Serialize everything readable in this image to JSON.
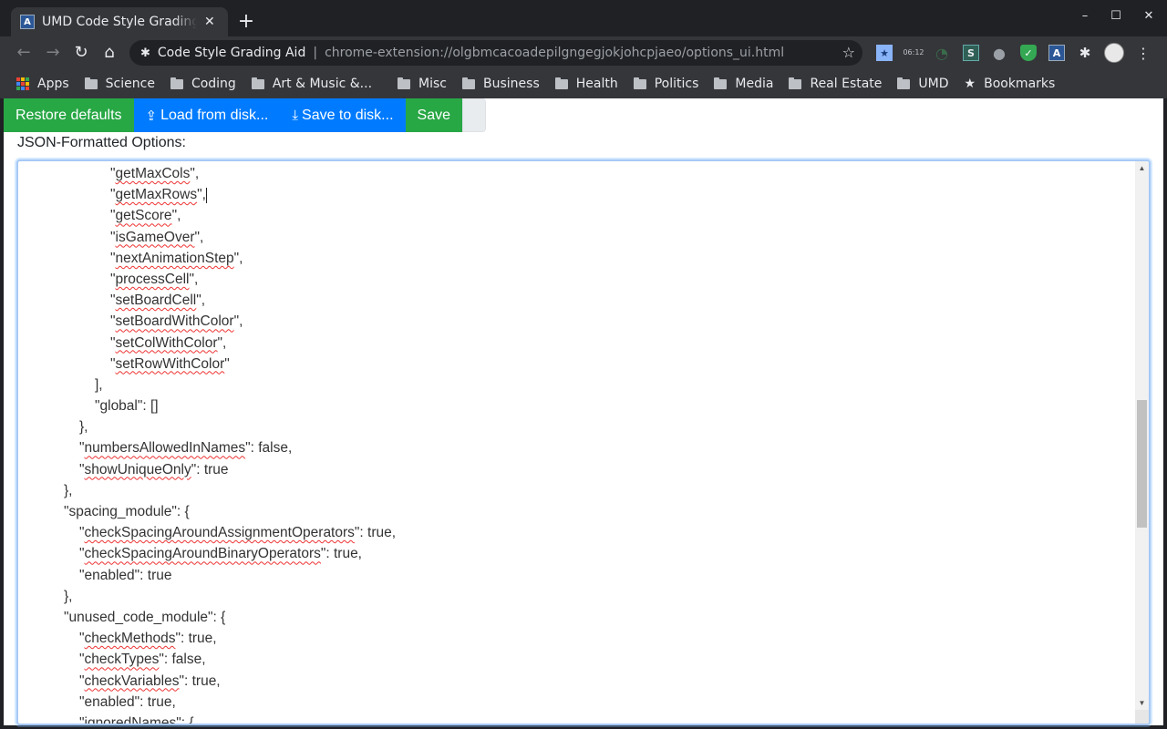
{
  "browser": {
    "tab": {
      "title": "UMD Code Style Grading Extension",
      "favicon": "A"
    },
    "new_tab_label": "+",
    "window_controls": {
      "minimize": "–",
      "maximize": "☐",
      "close": "✕"
    },
    "nav": {
      "back": "←",
      "forward": "→",
      "reload": "↻",
      "home": "⌂"
    },
    "omnibox": {
      "site_name": "Code Style Grading Aid",
      "url": "chrome-extension://olgbmcacoadepilgngegjokjohcpjaeo/options_ui.html"
    },
    "extensions": [
      {
        "name": "bookmark-star-extension",
        "glyph": "★"
      },
      {
        "name": "clock-extension",
        "glyph": "06:12"
      },
      {
        "name": "timer-extension",
        "glyph": "◔"
      },
      {
        "name": "s-extension",
        "glyph": "S"
      },
      {
        "name": "speech-extension",
        "glyph": "●"
      },
      {
        "name": "shield-extension",
        "glyph": "✓"
      },
      {
        "name": "code-style-extension",
        "glyph": "A"
      },
      {
        "name": "extensions-menu",
        "glyph": "✱"
      }
    ],
    "menu_glyph": "⋮",
    "bookmarks": [
      {
        "label": "Apps",
        "type": "apps"
      },
      {
        "label": "Science",
        "type": "folder"
      },
      {
        "label": "Coding",
        "type": "folder"
      },
      {
        "label": "Art & Music &...",
        "type": "folder"
      },
      {
        "label": "Misc",
        "type": "folder"
      },
      {
        "label": "Business",
        "type": "folder"
      },
      {
        "label": "Health",
        "type": "folder"
      },
      {
        "label": "Politics",
        "type": "folder"
      },
      {
        "label": "Media",
        "type": "folder"
      },
      {
        "label": "Real Estate",
        "type": "folder"
      },
      {
        "label": "UMD",
        "type": "folder"
      },
      {
        "label": "Bookmarks",
        "type": "star"
      }
    ]
  },
  "page": {
    "buttons": {
      "restore_defaults": "Restore defaults",
      "load_from_disk": "Load from disk...",
      "save_to_disk": "Save to disk...",
      "save": "Save"
    },
    "options_label": "JSON-Formatted Options:",
    "editor_lines": [
      {
        "indent": 6,
        "parts": [
          [
            "\"",
            0
          ],
          [
            "getMaxCols",
            1
          ],
          [
            "\",",
            0
          ]
        ]
      },
      {
        "indent": 6,
        "parts": [
          [
            "\"",
            0
          ],
          [
            "getMaxRows",
            1
          ],
          [
            "\",",
            0
          ]
        ],
        "caret": true
      },
      {
        "indent": 6,
        "parts": [
          [
            "\"",
            0
          ],
          [
            "getScore",
            1
          ],
          [
            "\",",
            0
          ]
        ]
      },
      {
        "indent": 6,
        "parts": [
          [
            "\"",
            0
          ],
          [
            "isGameOver",
            1
          ],
          [
            "\",",
            0
          ]
        ]
      },
      {
        "indent": 6,
        "parts": [
          [
            "\"",
            0
          ],
          [
            "nextAnimationStep",
            1
          ],
          [
            "\",",
            0
          ]
        ]
      },
      {
        "indent": 6,
        "parts": [
          [
            "\"",
            0
          ],
          [
            "processCell",
            1
          ],
          [
            "\",",
            0
          ]
        ]
      },
      {
        "indent": 6,
        "parts": [
          [
            "\"",
            0
          ],
          [
            "setBoardCell",
            1
          ],
          [
            "\",",
            0
          ]
        ]
      },
      {
        "indent": 6,
        "parts": [
          [
            "\"",
            0
          ],
          [
            "setBoardWithColor",
            1
          ],
          [
            "\",",
            0
          ]
        ]
      },
      {
        "indent": 6,
        "parts": [
          [
            "\"",
            0
          ],
          [
            "setColWithColor",
            1
          ],
          [
            "\",",
            0
          ]
        ]
      },
      {
        "indent": 6,
        "parts": [
          [
            "\"",
            0
          ],
          [
            "setRowWithColor",
            1
          ],
          [
            "\"",
            0
          ]
        ]
      },
      {
        "indent": 5,
        "parts": [
          [
            "],",
            0
          ]
        ]
      },
      {
        "indent": 5,
        "parts": [
          [
            "\"global\": []",
            0
          ]
        ]
      },
      {
        "indent": 4,
        "parts": [
          [
            "},",
            0
          ]
        ]
      },
      {
        "indent": 4,
        "parts": [
          [
            "\"",
            0
          ],
          [
            "numbersAllowedInNames",
            1
          ],
          [
            "\": false,",
            0
          ]
        ]
      },
      {
        "indent": 4,
        "parts": [
          [
            "\"",
            0
          ],
          [
            "showUniqueOnly",
            1
          ],
          [
            "\": true",
            0
          ]
        ]
      },
      {
        "indent": 3,
        "parts": [
          [
            "},",
            0
          ]
        ]
      },
      {
        "indent": 3,
        "parts": [
          [
            "\"spacing_module\": {",
            0
          ]
        ]
      },
      {
        "indent": 4,
        "parts": [
          [
            "\"",
            0
          ],
          [
            "checkSpacingAroundAssignmentOperators",
            1
          ],
          [
            "\": true,",
            0
          ]
        ]
      },
      {
        "indent": 4,
        "parts": [
          [
            "\"",
            0
          ],
          [
            "checkSpacingAroundBinaryOperators",
            1
          ],
          [
            "\": true,",
            0
          ]
        ]
      },
      {
        "indent": 4,
        "parts": [
          [
            "\"enabled\": true",
            0
          ]
        ]
      },
      {
        "indent": 3,
        "parts": [
          [
            "},",
            0
          ]
        ]
      },
      {
        "indent": 3,
        "parts": [
          [
            "\"unused_code_module\": {",
            0
          ]
        ]
      },
      {
        "indent": 4,
        "parts": [
          [
            "\"",
            0
          ],
          [
            "checkMethods",
            1
          ],
          [
            "\": true,",
            0
          ]
        ]
      },
      {
        "indent": 4,
        "parts": [
          [
            "\"",
            0
          ],
          [
            "checkTypes",
            1
          ],
          [
            "\": false,",
            0
          ]
        ]
      },
      {
        "indent": 4,
        "parts": [
          [
            "\"",
            0
          ],
          [
            "checkVariables",
            1
          ],
          [
            "\": true,",
            0
          ]
        ]
      },
      {
        "indent": 4,
        "parts": [
          [
            "\"enabled\": true,",
            0
          ]
        ]
      },
      {
        "indent": 4,
        "parts": [
          [
            "\"ignoredNames\": {",
            0
          ]
        ]
      }
    ],
    "scrollbar": {
      "up": "▲",
      "down": "▼",
      "position_fraction": 0.42,
      "visible_fraction": 0.24
    }
  },
  "colors": {
    "green": "#28a745",
    "blue": "#007bff",
    "browser_dark": "#202124",
    "browser_toolbar": "#35363a",
    "focus_border": "#a6c8f5",
    "spellcheck": "#ee3333"
  }
}
